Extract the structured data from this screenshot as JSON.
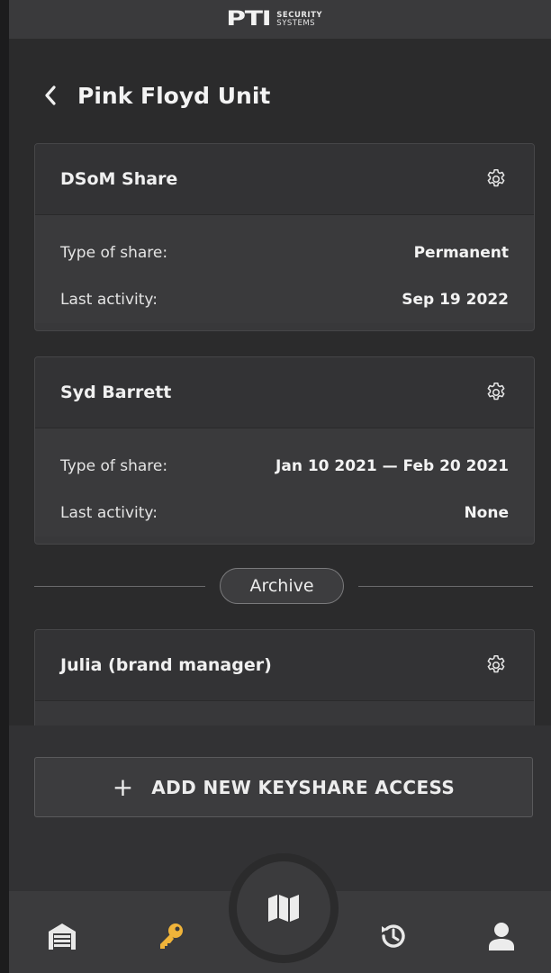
{
  "header": {
    "logo_mark": "PTI",
    "logo_line1": "SECURITY",
    "logo_line2": "SYSTEMS"
  },
  "page": {
    "title": "Pink Floyd Unit"
  },
  "cards": [
    {
      "name": "DSoM Share",
      "rows": [
        {
          "label": "Type of share:",
          "value": "Permanent"
        },
        {
          "label": "Last activity:",
          "value": "Sep 19 2022"
        }
      ]
    },
    {
      "name": "Syd Barrett",
      "rows": [
        {
          "label": "Type of share:",
          "value": "Jan 10 2021 — Feb 20 2021"
        },
        {
          "label": "Last activity:",
          "value": "None"
        }
      ]
    }
  ],
  "archive": {
    "label": "Archive",
    "cards": [
      {
        "name": "Julia (brand manager)"
      }
    ]
  },
  "actions": {
    "add_icon": "+",
    "add_label": "ADD NEW KEYSHARE ACCESS"
  },
  "nav": {
    "items": [
      {
        "icon": "garage-icon",
        "active": false
      },
      {
        "icon": "key-icon",
        "active": true
      },
      {
        "icon": "map-icon",
        "active": false
      },
      {
        "icon": "history-icon",
        "active": false
      },
      {
        "icon": "user-icon",
        "active": false
      }
    ],
    "active_color": "#f0b43a"
  },
  "colors": {
    "background": "#2b2b2c",
    "card": "#38383a",
    "accent": "#f0b43a"
  }
}
